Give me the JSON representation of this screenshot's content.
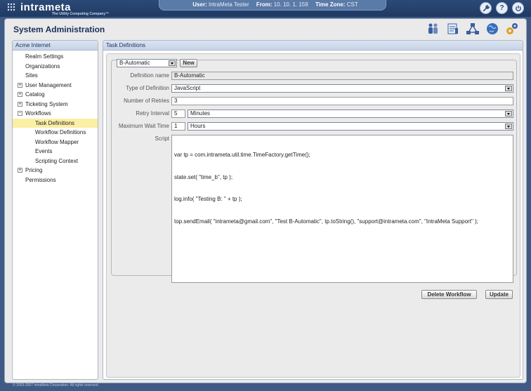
{
  "brand": {
    "name": "intrameta",
    "tagline": "The Utility Computing Company™"
  },
  "session": {
    "user_label": "User:",
    "user_value": "IntraMeta Tester",
    "from_label": "From:",
    "from_value": "10. 10. 1. 159",
    "tz_label": "Time Zone:",
    "tz_value": "CST"
  },
  "top_icons": [
    "wrench-icon",
    "help-icon",
    "power-icon"
  ],
  "page": {
    "title": "System Administration"
  },
  "toolbar_icons": [
    "users-icon",
    "forms-icon",
    "network-icon",
    "globe-icon",
    "gears-icon"
  ],
  "sidebar": {
    "title": "Acme Internet",
    "items": [
      {
        "label": "Realm Settings",
        "level": 1,
        "expander": ""
      },
      {
        "label": "Organizations",
        "level": 1,
        "expander": ""
      },
      {
        "label": "Sites",
        "level": 1,
        "expander": ""
      },
      {
        "label": "User Management",
        "level": 1,
        "expander": "+"
      },
      {
        "label": "Catalog",
        "level": 1,
        "expander": "+"
      },
      {
        "label": "Ticketing System",
        "level": 1,
        "expander": "+"
      },
      {
        "label": "Workflows",
        "level": 1,
        "expander": "−"
      },
      {
        "label": "Task Definitions",
        "level": 2,
        "expander": "",
        "active": true
      },
      {
        "label": "Workflow Definitions",
        "level": 2,
        "expander": ""
      },
      {
        "label": "Workflow Mapper",
        "level": 2,
        "expander": ""
      },
      {
        "label": "Events",
        "level": 2,
        "expander": ""
      },
      {
        "label": "Scripting Context",
        "level": 2,
        "expander": ""
      },
      {
        "label": "Pricing",
        "level": 1,
        "expander": "+"
      },
      {
        "label": "Permissions",
        "level": 1,
        "expander": ""
      }
    ]
  },
  "content": {
    "title": "Task Definitions",
    "task_select": "B-Automatic",
    "new_button": "New",
    "form": {
      "definition_name_label": "Definition name",
      "definition_name_value": "B-Automatic",
      "type_label": "Type of Definition",
      "type_value": "JavaScript",
      "retries_label": "Number of Retries",
      "retries_value": "3",
      "retry_interval_label": "Retry Interval",
      "retry_interval_value": "5",
      "retry_interval_unit": "Minutes",
      "max_wait_label": "Maximum Wait Time",
      "max_wait_value": "1",
      "max_wait_unit": "Hours",
      "script_label": "Script",
      "script_lines": [
        "var tp = com.intrameta.util.time.TimeFactory.getTime();",
        "state.set( \"time_b\", tp );",
        "log.info( \"Testing B: \" + tp );",
        "top.sendEmail( \"intrameta@gmail.com\", \"Test B-Automatic\", tp.toString(), \"support@intrameta.com\", \"IntraMeta Support\" );"
      ]
    },
    "delete_button": "Delete Workflow",
    "update_button": "Update"
  },
  "footer": "© 2003-2007 IntraMeta Corporation.  All rights reserved."
}
